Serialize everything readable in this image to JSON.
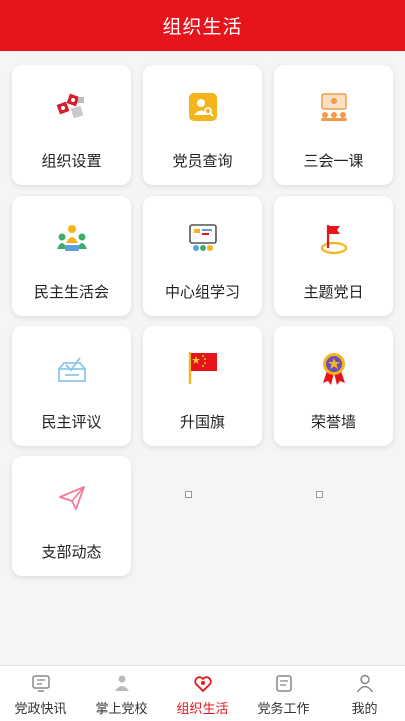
{
  "header": {
    "title": "组织生活"
  },
  "cards": [
    {
      "label": "组织设置",
      "icon": "org-settings-icon"
    },
    {
      "label": "党员查询",
      "icon": "member-search-icon"
    },
    {
      "label": "三会一课",
      "icon": "lecture-icon"
    },
    {
      "label": "民主生活会",
      "icon": "group-meeting-icon"
    },
    {
      "label": "中心组学习",
      "icon": "study-board-icon"
    },
    {
      "label": "主题党日",
      "icon": "flag-icon"
    },
    {
      "label": "民主评议",
      "icon": "ballot-box-icon"
    },
    {
      "label": "升国旗",
      "icon": "national-flag-icon"
    },
    {
      "label": "荣誉墙",
      "icon": "medal-icon"
    },
    {
      "label": "支部动态",
      "icon": "paper-plane-icon"
    }
  ],
  "tabbar": {
    "active": "组织生活",
    "items": [
      {
        "label": "党政快讯",
        "icon": "news-icon"
      },
      {
        "label": "掌上党校",
        "icon": "school-icon"
      },
      {
        "label": "组织生活",
        "icon": "heart-people-icon"
      },
      {
        "label": "党务工作",
        "icon": "work-icon"
      },
      {
        "label": "我的",
        "icon": "profile-icon"
      }
    ]
  },
  "colors": {
    "brand_red": "#e8141c",
    "gold": "#f4b41a"
  }
}
